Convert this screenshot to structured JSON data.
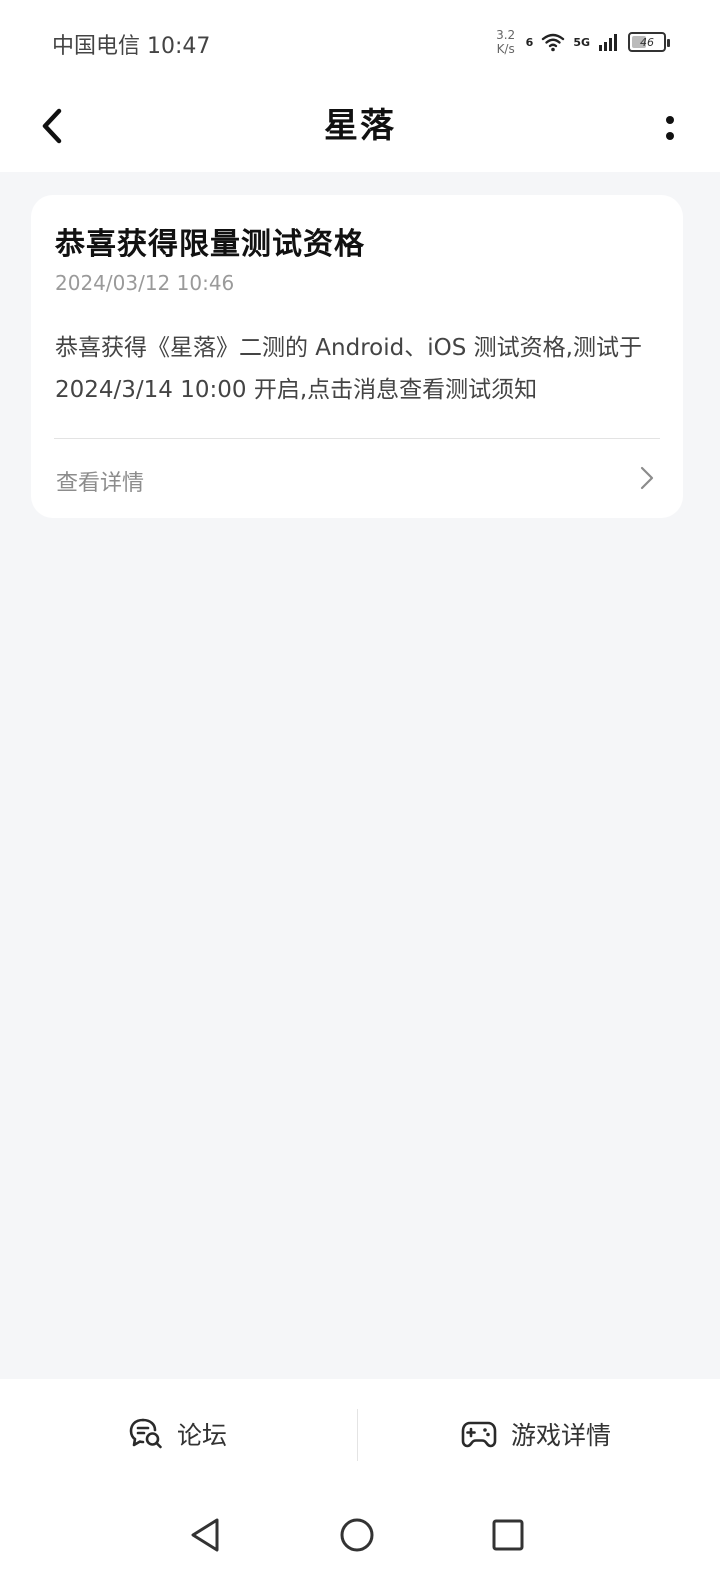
{
  "status_bar": {
    "carrier_time": "中国电信 10:47",
    "net_speed_value": "3.2",
    "net_speed_unit": "K/s",
    "wifi_label": "6",
    "cell_label": "5G",
    "battery_text": "46",
    "battery_level": 0.46
  },
  "header": {
    "title": "星落"
  },
  "message": {
    "title": "恭喜获得限量测试资格",
    "timestamp": "2024/03/12 10:46",
    "body": "恭喜获得《星落》二测的 Android、iOS 测试资格,测试于 2024/3/14 10:00 开启,点击消息查看测试须知",
    "footer_label": "查看详情"
  },
  "bottom_bar": {
    "forum_label": "论坛",
    "game_details_label": "游戏详情"
  },
  "colors": {
    "page_background": "#f5f6f8",
    "card_background": "#ffffff",
    "secondary_text": "#9a9a9a"
  }
}
